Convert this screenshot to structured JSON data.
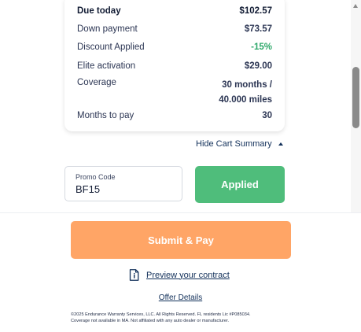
{
  "cart_summary": {
    "rows": [
      {
        "label": "Due today",
        "value": "$102.57"
      },
      {
        "label": "Down payment",
        "value": "$73.57"
      },
      {
        "label": "Discount Applied",
        "value": "-15%"
      },
      {
        "label": "Elite activation",
        "value": "$29.00"
      },
      {
        "label": "Coverage",
        "value_line1": "30 months /",
        "value_line2": "40.000 miles"
      },
      {
        "label": "Months to pay",
        "value": "30"
      }
    ],
    "toggle_label": "Hide Cart Summary"
  },
  "promo": {
    "label": "Promo Code",
    "value": "BF15",
    "button_label": "Applied"
  },
  "footer": {
    "submit_label": "Submit & Pay",
    "preview_contract_label": "Preview your contract",
    "offer_details_label": "Offer Details",
    "legal_line1": "©2025 Endurance Warranty Services, LLC. All Rights Reserved. FL residents Lic #P085034.",
    "legal_line2": "Coverage not available in MA. Not affiliated with any auto dealer or manufacturer."
  },
  "colors": {
    "discount_green": "#2ea86a",
    "applied_button": "#4fbd7b",
    "submit_button": "#ffa566",
    "link": "#12305a"
  },
  "icons": {
    "toggle": "caret-up-icon",
    "contract": "document-info-icon"
  }
}
